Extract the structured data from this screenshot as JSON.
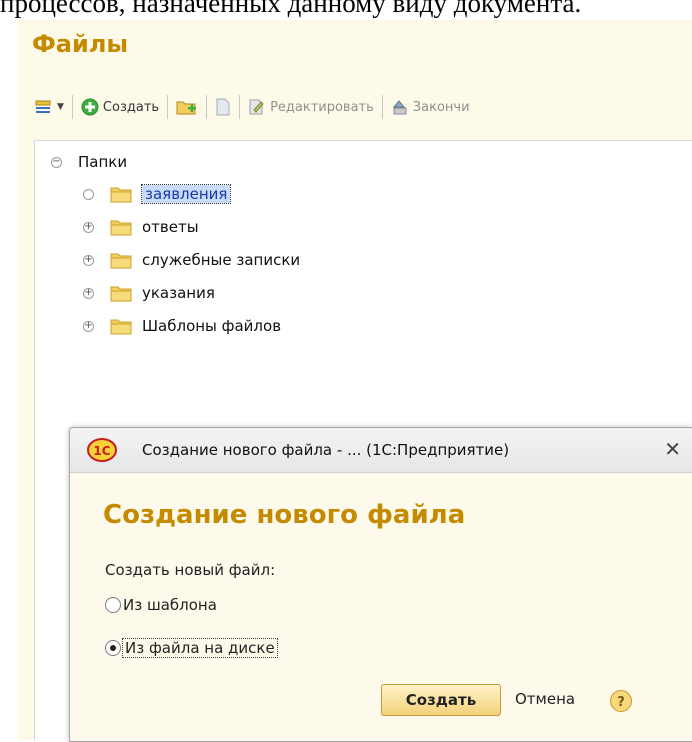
{
  "document_text": "процессов, назначенных данному виду документа.",
  "files_form": {
    "title": "Файлы",
    "toolbar": {
      "create_label": "Создать",
      "edit_label": "Редактировать",
      "finish_label": "Закончи"
    },
    "tree": {
      "root": "Папки",
      "items": [
        {
          "label": "заявления"
        },
        {
          "label": "ответы"
        },
        {
          "label": "служебные записки"
        },
        {
          "label": "указания"
        },
        {
          "label": "Шаблоны файлов"
        }
      ]
    }
  },
  "dialog": {
    "logo_text": "1С",
    "title": "Создание нового файла - ...  (1С:Предприятие)",
    "heading": "Создание нового файла",
    "prompt": "Создать новый файл:",
    "options": [
      {
        "label": "Из шаблона",
        "checked": false
      },
      {
        "label": "Из файла на диске",
        "checked": true
      }
    ],
    "create_button": "Создать",
    "cancel_button": "Отмена",
    "help_symbol": "?"
  },
  "colors": {
    "accent_gold": "#c48a00",
    "folder_yellow": "#f2cf5c",
    "selection_blue": "#c8dbf8",
    "add_green": "#3fae3f"
  }
}
